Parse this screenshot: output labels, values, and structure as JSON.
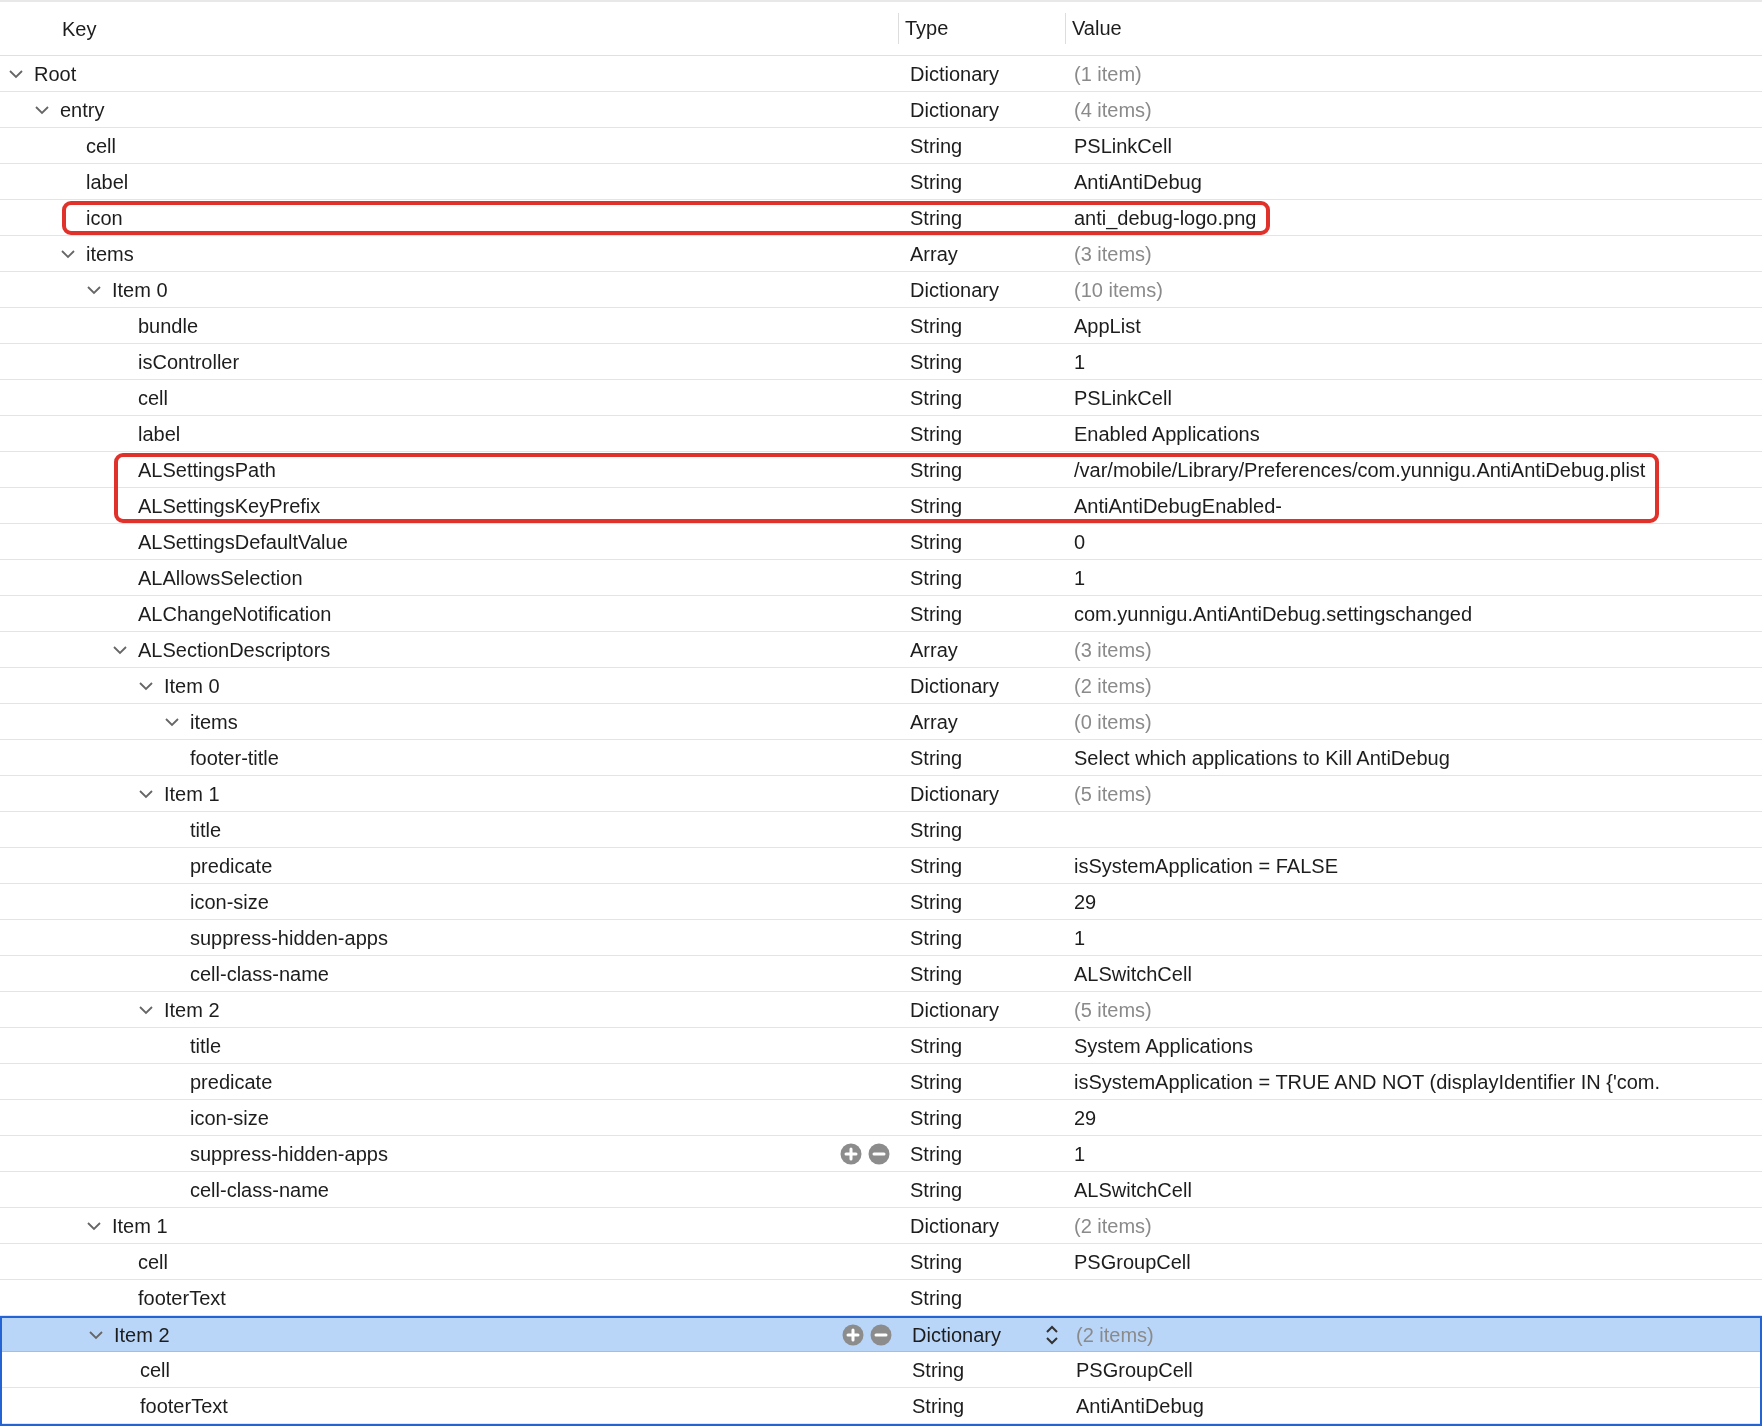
{
  "columns": [
    {
      "label": "Key"
    },
    {
      "label": "Type"
    },
    {
      "label": "Value"
    }
  ],
  "tree": [
    {
      "key": "Root",
      "type": "Dictionary",
      "value": "(1 item)",
      "expanded": true,
      "selected": false,
      "marked": false,
      "controls": false,
      "children": [
        {
          "key": "entry",
          "type": "Dictionary",
          "value": "(4 items)",
          "expanded": true,
          "selected": false,
          "marked": false,
          "controls": false,
          "children": [
            {
              "key": "cell",
              "type": "String",
              "value": "PSLinkCell",
              "selected": false,
              "marked": false,
              "controls": false
            },
            {
              "key": "label",
              "type": "String",
              "value": "AntiAntiDebug",
              "selected": false,
              "marked": false,
              "controls": false
            },
            {
              "key": "icon",
              "type": "String",
              "value": "anti_debug-logo.png",
              "selected": false,
              "marked": true,
              "controls": false
            },
            {
              "key": "items",
              "type": "Array",
              "value": "(3 items)",
              "expanded": true,
              "selected": false,
              "marked": false,
              "controls": false,
              "children": [
                {
                  "key": "Item 0",
                  "type": "Dictionary",
                  "value": "(10 items)",
                  "expanded": true,
                  "selected": false,
                  "marked": false,
                  "controls": false,
                  "children": [
                    {
                      "key": "bundle",
                      "type": "String",
                      "value": "AppList",
                      "selected": false,
                      "marked": false,
                      "controls": false
                    },
                    {
                      "key": "isController",
                      "type": "String",
                      "value": "1",
                      "selected": false,
                      "marked": false,
                      "controls": false
                    },
                    {
                      "key": "cell",
                      "type": "String",
                      "value": "PSLinkCell",
                      "selected": false,
                      "marked": false,
                      "controls": false
                    },
                    {
                      "key": "label",
                      "type": "String",
                      "value": "Enabled Applications",
                      "selected": false,
                      "marked": false,
                      "controls": false
                    },
                    {
                      "key": "ALSettingsPath",
                      "type": "String",
                      "value": "/var/mobile/Library/Preferences/com.yunnigu.AntiAntiDebug.plist",
                      "selected": false,
                      "marked": true,
                      "controls": false
                    },
                    {
                      "key": "ALSettingsKeyPrefix",
                      "type": "String",
                      "value": "AntiAntiDebugEnabled-",
                      "selected": false,
                      "marked": true,
                      "controls": false
                    },
                    {
                      "key": "ALSettingsDefaultValue",
                      "type": "String",
                      "value": "0",
                      "selected": false,
                      "marked": false,
                      "controls": false
                    },
                    {
                      "key": "ALAllowsSelection",
                      "type": "String",
                      "value": "1",
                      "selected": false,
                      "marked": false,
                      "controls": false
                    },
                    {
                      "key": "ALChangeNotification",
                      "type": "String",
                      "value": "com.yunnigu.AntiAntiDebug.settingschanged",
                      "selected": false,
                      "marked": false,
                      "controls": false
                    },
                    {
                      "key": "ALSectionDescriptors",
                      "type": "Array",
                      "value": "(3 items)",
                      "expanded": true,
                      "selected": false,
                      "marked": false,
                      "controls": false,
                      "children": [
                        {
                          "key": "Item 0",
                          "type": "Dictionary",
                          "value": "(2 items)",
                          "expanded": true,
                          "selected": false,
                          "marked": false,
                          "controls": false,
                          "children": [
                            {
                              "key": "items",
                              "type": "Array",
                              "value": "(0 items)",
                              "expanded": true,
                              "selected": false,
                              "marked": false,
                              "controls": false
                            },
                            {
                              "key": "footer-title",
                              "type": "String",
                              "value": "Select which applications to Kill AntiDebug",
                              "selected": false,
                              "marked": false,
                              "controls": false
                            }
                          ]
                        },
                        {
                          "key": "Item 1",
                          "type": "Dictionary",
                          "value": "(5 items)",
                          "expanded": true,
                          "selected": false,
                          "marked": false,
                          "controls": false,
                          "children": [
                            {
                              "key": "title",
                              "type": "String",
                              "selected": false,
                              "marked": false,
                              "controls": false
                            },
                            {
                              "key": "predicate",
                              "type": "String",
                              "value": "isSystemApplication = FALSE",
                              "selected": false,
                              "marked": false,
                              "controls": false
                            },
                            {
                              "key": "icon-size",
                              "type": "String",
                              "value": "29",
                              "selected": false,
                              "marked": false,
                              "controls": false
                            },
                            {
                              "key": "suppress-hidden-apps",
                              "type": "String",
                              "value": "1",
                              "selected": false,
                              "marked": false,
                              "controls": false
                            },
                            {
                              "key": "cell-class-name",
                              "type": "String",
                              "value": "ALSwitchCell",
                              "selected": false,
                              "marked": false,
                              "controls": false
                            }
                          ]
                        },
                        {
                          "key": "Item 2",
                          "type": "Dictionary",
                          "value": "(5 items)",
                          "expanded": true,
                          "selected": false,
                          "marked": false,
                          "controls": false,
                          "children": [
                            {
                              "key": "title",
                              "type": "String",
                              "value": "System Applications",
                              "selected": false,
                              "marked": false,
                              "controls": false
                            },
                            {
                              "key": "predicate",
                              "type": "String",
                              "value": "isSystemApplication = TRUE AND NOT (displayIdentifier IN {'com.",
                              "selected": false,
                              "marked": false,
                              "controls": false
                            },
                            {
                              "key": "icon-size",
                              "type": "String",
                              "value": "29",
                              "selected": false,
                              "marked": false,
                              "controls": false
                            },
                            {
                              "key": "suppress-hidden-apps",
                              "type": "String",
                              "value": "1",
                              "selected": false,
                              "marked": false,
                              "controls": true
                            },
                            {
                              "key": "cell-class-name",
                              "type": "String",
                              "value": "ALSwitchCell",
                              "selected": false,
                              "marked": false,
                              "controls": false
                            }
                          ]
                        }
                      ]
                    }
                  ]
                },
                {
                  "key": "Item 1",
                  "type": "Dictionary",
                  "value": "(2 items)",
                  "expanded": true,
                  "selected": false,
                  "marked": false,
                  "controls": false,
                  "children": [
                    {
                      "key": "cell",
                      "type": "String",
                      "value": "PSGroupCell",
                      "selected": false,
                      "marked": false,
                      "controls": false
                    },
                    {
                      "key": "footerText",
                      "type": "String",
                      "selected": false,
                      "marked": false,
                      "controls": false
                    }
                  ]
                },
                {
                  "key": "Item 2",
                  "type": "Dictionary",
                  "value": "(2 items)",
                  "expanded": true,
                  "selected": true,
                  "marked": false,
                  "controls": true,
                  "children": [
                    {
                      "key": "cell",
                      "type": "String",
                      "value": "PSGroupCell",
                      "selected": false,
                      "marked": false,
                      "controls": false
                    },
                    {
                      "key": "footerText",
                      "type": "String",
                      "value": "AntiAntiDebug",
                      "selected": false,
                      "marked": false,
                      "controls": false
                    }
                  ]
                }
              ]
            }
          ]
        }
      ]
    }
  ]
}
